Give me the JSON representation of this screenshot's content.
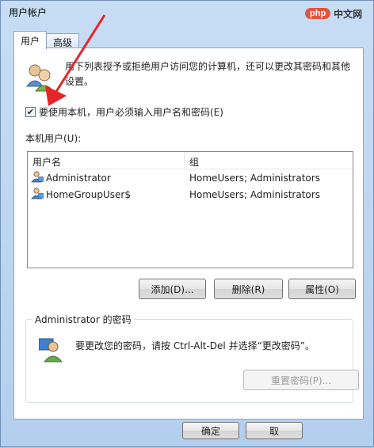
{
  "window": {
    "title": "用户帐户",
    "watermark": {
      "logo": "php",
      "text": "中文网"
    }
  },
  "tabs": [
    {
      "label": "用户",
      "active": true
    },
    {
      "label": "高级",
      "active": false
    }
  ],
  "intro_text": "用下列表授予或拒绝用户访问您的计算机，还可以更改其密码和其他设置。",
  "require_login": {
    "label": "要使用本机，用户必须输入用户名和密码(E)",
    "checked": true,
    "mark": "✔"
  },
  "local_users_label": "本机用户(U):",
  "users_table": {
    "columns": [
      "用户名",
      "组"
    ],
    "rows": [
      {
        "name": "Administrator",
        "group": "HomeUsers; Administrators",
        "icon": "user-icon"
      },
      {
        "name": "HomeGroupUser$",
        "group": "HomeUsers; Administrators",
        "icon": "user-icon"
      }
    ]
  },
  "buttons": {
    "add": "添加(D)...",
    "remove": "删除(R)",
    "properties": "属性(O)"
  },
  "password_group": {
    "title": "Administrator 的密码",
    "text": "要更改您的密码，请按 Ctrl-Alt-Del 并选择“更改密码”。",
    "reset_button": "重置密码(P)..."
  },
  "footer": {
    "ok": "确定",
    "cancel": "取"
  },
  "colors": {
    "window_bg": "#b4cfee",
    "arrow": "#e4262a",
    "panel_bg": "#ffffff"
  }
}
